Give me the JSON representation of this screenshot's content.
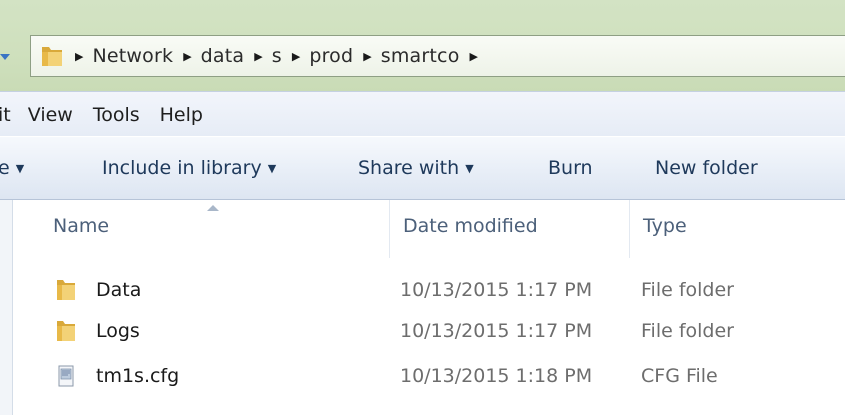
{
  "address_bar": {
    "breadcrumbs": [
      "Network",
      "data",
      "s",
      "prod",
      "smartco"
    ]
  },
  "menu": {
    "items": [
      "it",
      "View",
      "Tools",
      "Help"
    ]
  },
  "toolbar": {
    "partial_left": "e",
    "include_in_library": "Include in library",
    "share_with": "Share with",
    "burn": "Burn",
    "new_folder": "New folder"
  },
  "file_list": {
    "columns": [
      "Name",
      "Date modified",
      "Type"
    ],
    "sorted_by": "Name",
    "rows": [
      {
        "name": "Data",
        "date": "10/13/2015 1:17 PM",
        "type": "File folder",
        "icon": "folder-icon"
      },
      {
        "name": "Logs",
        "date": "10/13/2015 1:17 PM",
        "type": "File folder",
        "icon": "folder-icon"
      },
      {
        "name": "tm1s.cfg",
        "date": "10/13/2015 1:18 PM",
        "type": "CFG File",
        "icon": "document-icon"
      }
    ]
  },
  "colors": {
    "address_bg": "#d3e3c4",
    "menubar_bg": "#e6ecf6",
    "toolbar_text": "#1e395b",
    "folder_yellow": "#e8c35a"
  }
}
